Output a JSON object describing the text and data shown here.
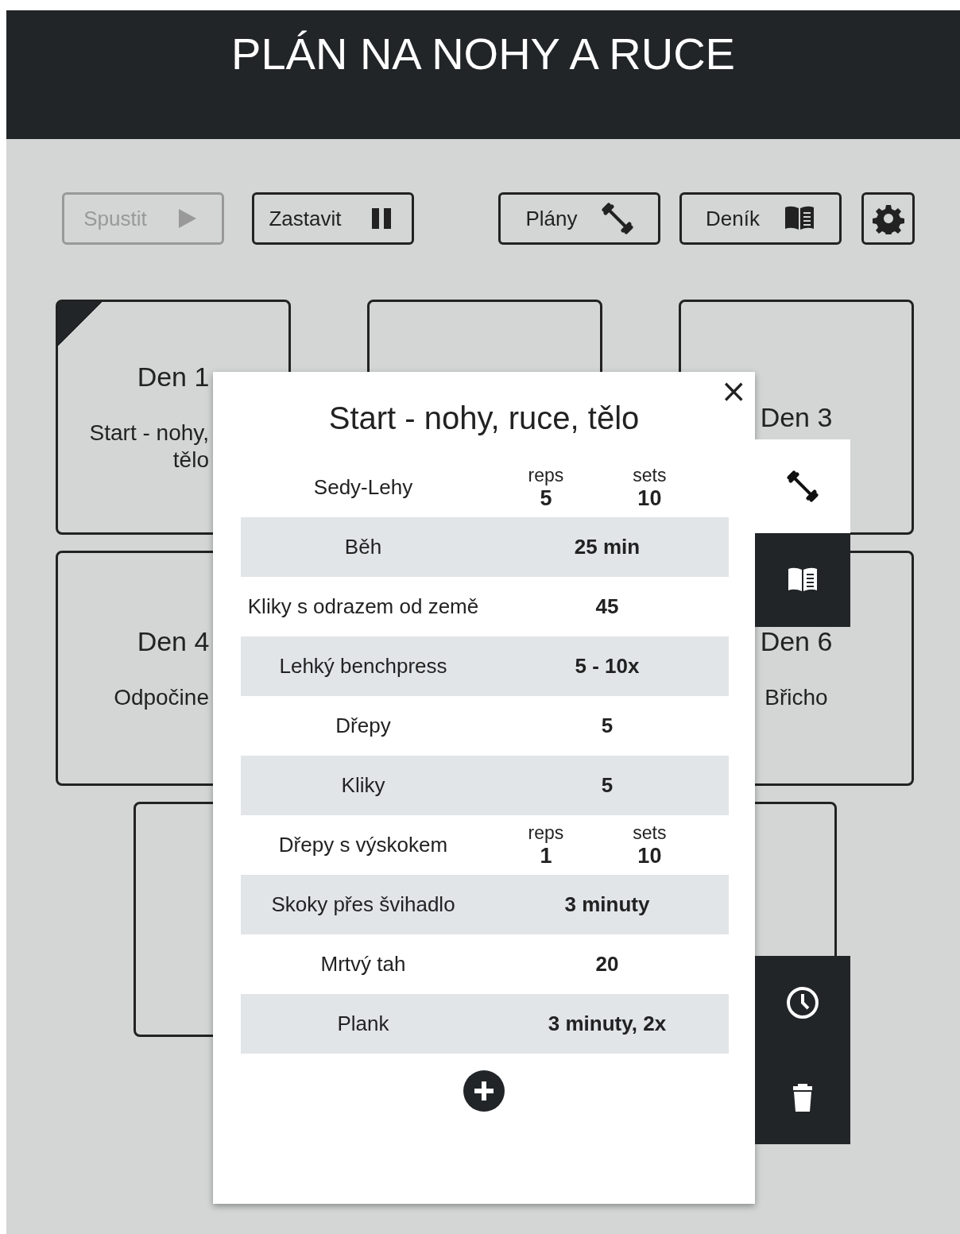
{
  "header": {
    "title": "PLÁN NA NOHY A RUCE"
  },
  "toolbar": [
    {
      "label": "Spustit",
      "disabled": true
    },
    {
      "label": "Zastavit",
      "disabled": false
    },
    {
      "label": "Plány",
      "disabled": false
    },
    {
      "label": "Deník",
      "disabled": false
    }
  ],
  "cards": [
    {
      "kind": "day",
      "title": "Den 1",
      "lines": [
        "Start - nohy,",
        "tělo"
      ],
      "selected": true
    },
    {
      "kind": "day",
      "selected": false
    },
    {
      "kind": "day",
      "title": "Den 3",
      "selected": false
    },
    {
      "kind": "day",
      "title": "Den 4",
      "lines": [
        "Odpočine"
      ],
      "selected": false
    },
    {
      "kind": "day",
      "title": "Den 6",
      "lines": [
        "Břicho"
      ]
    },
    {
      "kind": "day",
      "selected": false
    },
    {
      "kind": "day"
    }
  ],
  "side_tabs": [
    {
      "selected": true
    },
    {
      "selected": false
    }
  ],
  "modal": {
    "title": "Start - nohy, ruce, tělo",
    "close": "×",
    "exercises": [
      {
        "kind": "reps_sets",
        "name": "Sedy-Lehy",
        "reps_label": "reps",
        "reps": "5",
        "sets_label": "sets",
        "sets": "10"
      },
      {
        "kind": "value",
        "name": "Běh",
        "value": "25 min"
      },
      {
        "kind": "value",
        "name": "Kliky s odrazem od země",
        "value": "45"
      },
      {
        "kind": "value",
        "name": "Lehký benchpress",
        "value": "5 - 10x"
      },
      {
        "kind": "value",
        "name": "Dřepy",
        "value": "5"
      },
      {
        "kind": "value",
        "name": "Kliky",
        "value": "5"
      },
      {
        "kind": "reps_sets",
        "name": "Dřepy s výskokem",
        "reps_label": "reps",
        "reps": "1",
        "sets_label": "sets",
        "sets": "10"
      },
      {
        "kind": "value",
        "name": "Skoky přes švihadlo",
        "value": "3 minuty"
      },
      {
        "kind": "value",
        "name": "Mrtvý tah",
        "value": "20"
      },
      {
        "kind": "value",
        "name": "Plank",
        "value": "3 minuty, 2x"
      }
    ]
  }
}
